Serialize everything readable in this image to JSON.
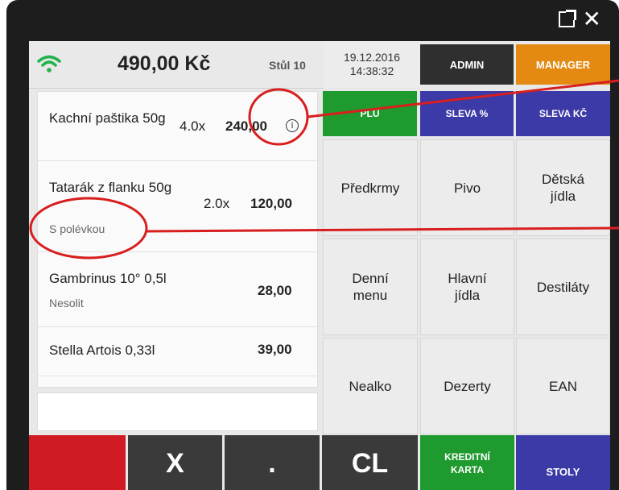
{
  "window": {
    "external_icon": "external-link-icon",
    "close_label": "✕"
  },
  "header": {
    "wifi_icon": "wifi-icon",
    "wifi_color": "#22b24c",
    "total": "490,00 Kč",
    "table": "Stůl 10",
    "date": "19.12.2016",
    "time": "14:38:32",
    "admin_label": "ADMIN",
    "manager_label": "MANAGER"
  },
  "orders": [
    {
      "name": "Kachní paštika 50g",
      "qty": "4.0x",
      "price": "240,00",
      "note": "",
      "has_info": true
    },
    {
      "name": "Tatarák z flanku 50g",
      "qty": "2.0x",
      "price": "120,00",
      "note": "S polévkou",
      "has_info": false
    },
    {
      "name": "Gambrinus 10° 0,5l",
      "qty": "",
      "price": "28,00",
      "note": "Nesolit",
      "has_info": false
    },
    {
      "name": "Stella Artois 0,33l",
      "qty": "",
      "price": "39,00",
      "note": "",
      "has_info": false
    }
  ],
  "top_buttons": {
    "plu": "PLU",
    "sleva_pct": "SLEVA %",
    "sleva_kc": "SLEVA KČ"
  },
  "categories": {
    "predkrmy": "Předkrmy",
    "pivo": "Pivo",
    "detska_1": "Dětská",
    "detska_2": "jídla",
    "denni_1": "Denní",
    "denni_2": "menu",
    "hlavni_1": "Hlavní",
    "hlavni_2": "jídla",
    "destilaty": "Destiláty",
    "nealko": "Nealko",
    "dezerty": "Dezerty",
    "ean": "EAN"
  },
  "bottom": {
    "x_label": "X",
    "dot_label": ".",
    "cl_label": "CL",
    "kredit_1": "KREDITNÍ",
    "kredit_2": "KARTA",
    "stoly_label": "STOLY"
  },
  "colors": {
    "plu": "#1e9a2e",
    "sleva": "#3b3aa6",
    "manager": "#e48a12",
    "admin": "#2f2f2f",
    "red": "#d11b24",
    "dark": "#3a3a3a",
    "annotation": "#d81e1e"
  }
}
